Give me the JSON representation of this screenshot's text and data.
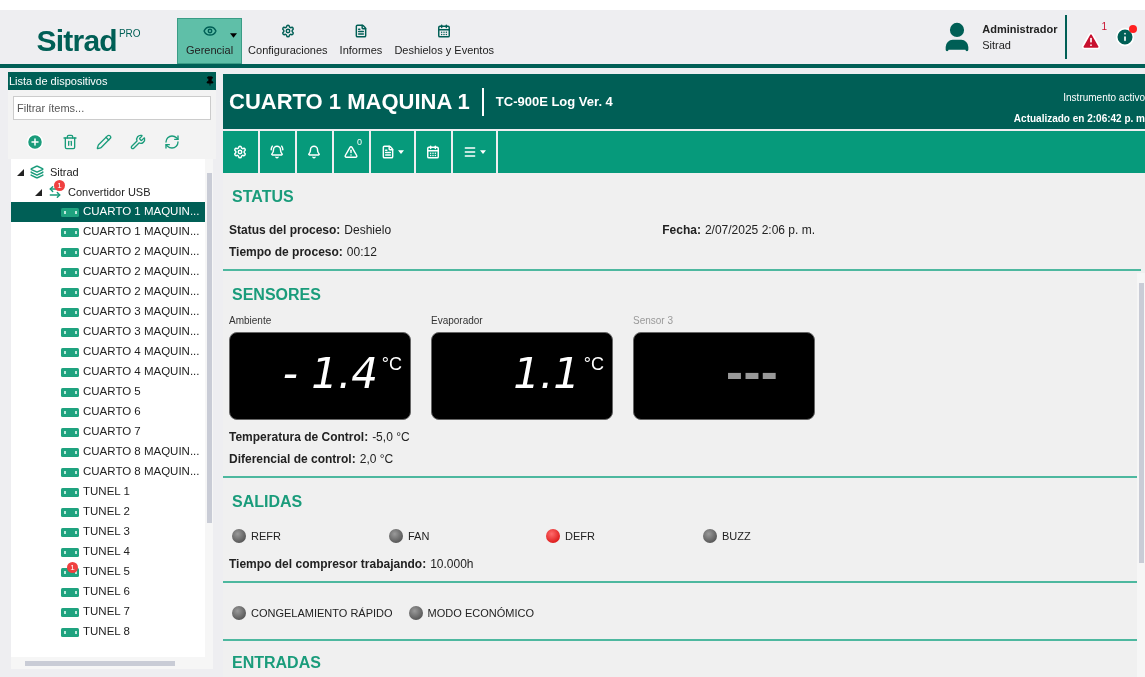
{
  "logo": {
    "name": "Sitrad",
    "suffix": "PRO"
  },
  "nav": [
    {
      "label": "Gerencial",
      "selected": true,
      "dropdown": true
    },
    {
      "label": "Configuraciones",
      "selected": false,
      "dropdown": false
    },
    {
      "label": "Informes",
      "selected": false,
      "dropdown": false
    },
    {
      "label": "Deshielos y Eventos",
      "selected": false,
      "dropdown": false
    }
  ],
  "user": {
    "name": "Administrador",
    "org": "Sitrad"
  },
  "alerts": {
    "count": "1"
  },
  "sidebar": {
    "title": "Lista de dispositivos",
    "filter": {
      "placeholder": "Filtrar ítems..."
    },
    "tree": [
      {
        "label": "Sitrad",
        "expanded": true,
        "children": [
          {
            "label": "Convertidor USB",
            "badge": "1",
            "expanded": true,
            "children": [
              {
                "label": "CUARTO 1 MAQUIN...",
                "selected": true
              },
              {
                "label": "CUARTO 1 MAQUIN...",
                "selected": false
              },
              {
                "label": "CUARTO 2 MAQUIN...",
                "selected": false
              },
              {
                "label": "CUARTO 2 MAQUIN...",
                "selected": false
              },
              {
                "label": "CUARTO 2 MAQUIN...",
                "selected": false
              },
              {
                "label": "CUARTO 3 MAQUIN...",
                "selected": false
              },
              {
                "label": "CUARTO 3 MAQUIN...",
                "selected": false
              },
              {
                "label": "CUARTO 4 MAQUIN...",
                "selected": false
              },
              {
                "label": "CUARTO 4 MAQUIN...",
                "selected": false
              },
              {
                "label": "CUARTO 5",
                "selected": false
              },
              {
                "label": "CUARTO 6",
                "selected": false
              },
              {
                "label": "CUARTO 7",
                "selected": false
              },
              {
                "label": "CUARTO 8 MAQUIN...",
                "selected": false
              },
              {
                "label": "CUARTO 8 MAQUIN...",
                "selected": false
              },
              {
                "label": "TUNEL 1",
                "selected": false
              },
              {
                "label": "TUNEL 2",
                "selected": false
              },
              {
                "label": "TUNEL 3",
                "selected": false
              },
              {
                "label": "TUNEL 4",
                "selected": false
              },
              {
                "label": "TUNEL 5",
                "selected": false,
                "badge": "1"
              },
              {
                "label": "TUNEL 6",
                "selected": false
              },
              {
                "label": "TUNEL 7",
                "selected": false
              },
              {
                "label": "TUNEL 8",
                "selected": false
              }
            ]
          }
        ]
      }
    ]
  },
  "device": {
    "name": "CUARTO 1 MAQUINA 1",
    "model": "TC-900E Log  Ver. 4",
    "status": "Instrumento activo",
    "updated": "Actualizado en 2:06:42 p. m"
  },
  "toolbar": [
    {
      "dropdown": false
    },
    {
      "dropdown": false
    },
    {
      "dropdown": false
    },
    {
      "badge": "0",
      "dropdown": false
    },
    {
      "dropdown": true
    },
    {
      "dropdown": false
    },
    {
      "dropdown": true
    }
  ],
  "status": {
    "title": "STATUS",
    "fields": [
      {
        "label": "Status del proceso:",
        "value": "Deshielo"
      },
      {
        "label": "Tiempo de proceso:",
        "value": "00:12"
      }
    ],
    "date": {
      "label": "Fecha:",
      "value": "2/07/2025  2:06  p. m."
    }
  },
  "sensors": {
    "title": "SENSORES",
    "items": [
      {
        "label": "Ambiente",
        "value": "- 1.4",
        "unit": "°C",
        "disabled": false
      },
      {
        "label": "Evaporador",
        "value": "1.1",
        "unit": "°C",
        "disabled": false
      },
      {
        "label": "Sensor 3",
        "value": "---",
        "disabled": true
      }
    ],
    "fields": [
      {
        "label": "Temperatura de Control:",
        "value": "-5,0 °C"
      },
      {
        "label": "Diferencial de control:",
        "value": "2,0 °C"
      }
    ]
  },
  "outputs": {
    "title": "SALIDAS",
    "items": [
      {
        "label": "REFR",
        "on": false
      },
      {
        "label": "FAN",
        "on": false
      },
      {
        "label": "DEFR",
        "on": true
      },
      {
        "label": "BUZZ",
        "on": false
      }
    ],
    "fields": [
      {
        "label": "Tiempo del compresor trabajando:",
        "value": "10.000h"
      }
    ]
  },
  "modes": [
    {
      "label": "CONGELAMIENTO RÁPIDO",
      "on": false
    },
    {
      "label": "MODO ECONÓMICO",
      "on": false
    }
  ],
  "inputs": {
    "title": "ENTRADAS"
  }
}
